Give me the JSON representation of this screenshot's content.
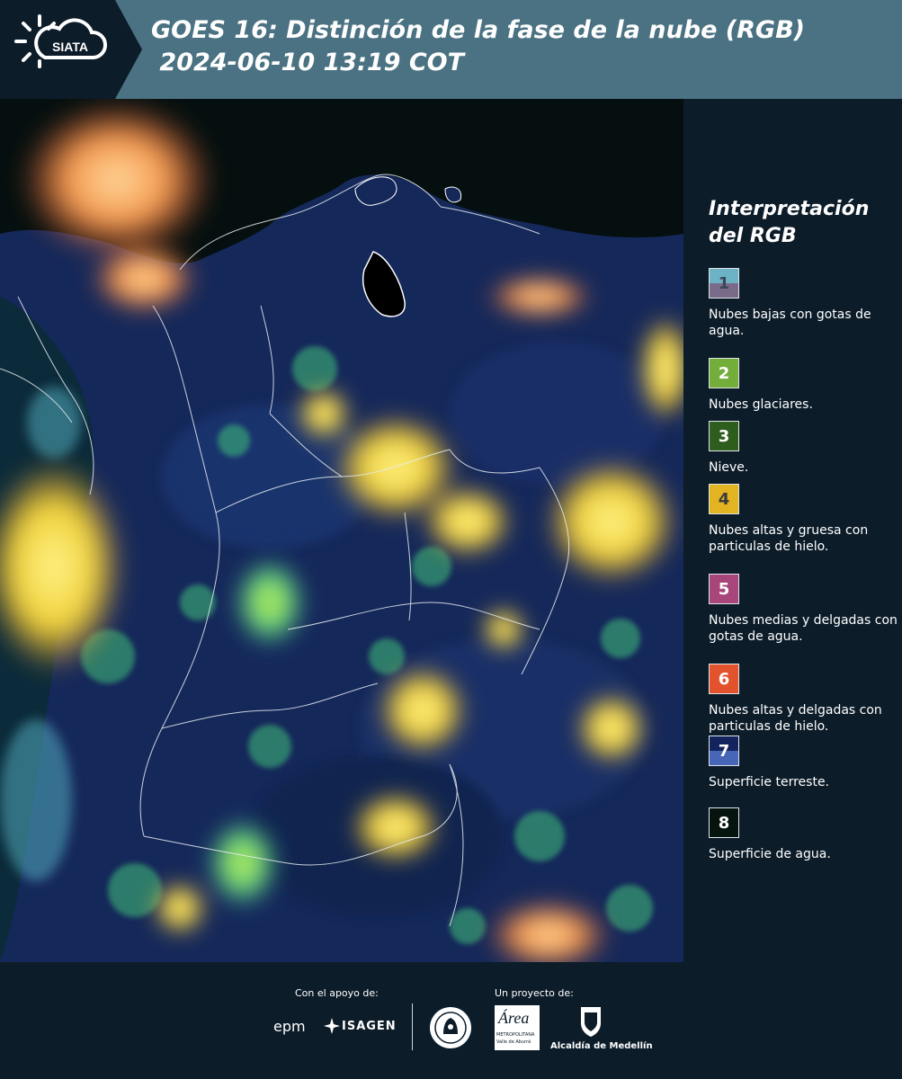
{
  "header": {
    "logo_text": "SIATA",
    "title_line1": "GOES 16: Distinción de la fase de la nube (RGB)",
    "title_line2": " 2024-06-10 13:19 COT"
  },
  "legend": {
    "title": "Interpretación del RGB",
    "items": [
      {
        "number": "1",
        "top_color": "#6cb3c6",
        "bottom_color": "#7a6b8a",
        "num_color": "#3d4656",
        "label": "Nubes bajas con gotas de agua."
      },
      {
        "number": "2",
        "top_color": "#73ad3a",
        "bottom_color": "#73ad3a",
        "num_color": "#ffffff",
        "label": "Nubes glaciares."
      },
      {
        "number": "3",
        "top_color": "#2e5e1e",
        "bottom_color": "#2e5e1e",
        "num_color": "#ffffff",
        "label": "Nieve."
      },
      {
        "number": "4",
        "top_color": "#e2b422",
        "bottom_color": "#e2b422",
        "num_color": "#3a3a3a",
        "label": "Nubes altas y gruesa con particulas de hielo."
      },
      {
        "number": "5",
        "top_color": "#a8467c",
        "bottom_color": "#a8467c",
        "num_color": "#ffffff",
        "label": "Nubes medias y delgadas con gotas de agua."
      },
      {
        "number": "6",
        "top_color": "#e2522c",
        "bottom_color": "#e2522c",
        "num_color": "#ffffff",
        "label": "Nubes altas y delgadas con particulas de hielo."
      },
      {
        "number": "7",
        "top_color": "#12235e",
        "bottom_color": "#4766b8",
        "num_color": "#ffffff",
        "label": "Superficie terreste."
      },
      {
        "number": "8",
        "top_color": "#061410",
        "bottom_color": "#061410",
        "num_color": "#ffffff",
        "label": "Superficie de agua."
      }
    ]
  },
  "footer": {
    "support_label": "Con el apoyo de:",
    "project_label": "Un proyecto de:",
    "epm": "epm",
    "isagen": "ISAGEN",
    "area_name": "Área",
    "area_sub": "METROPOLITANA",
    "area_sub2": "Valle de Aburrá",
    "alcaldia": "Alcaldía de Medellín"
  },
  "colors": {
    "background": "#0c1c29",
    "header": "#4a7282",
    "land": "#15285a",
    "water": "#050d0d"
  }
}
